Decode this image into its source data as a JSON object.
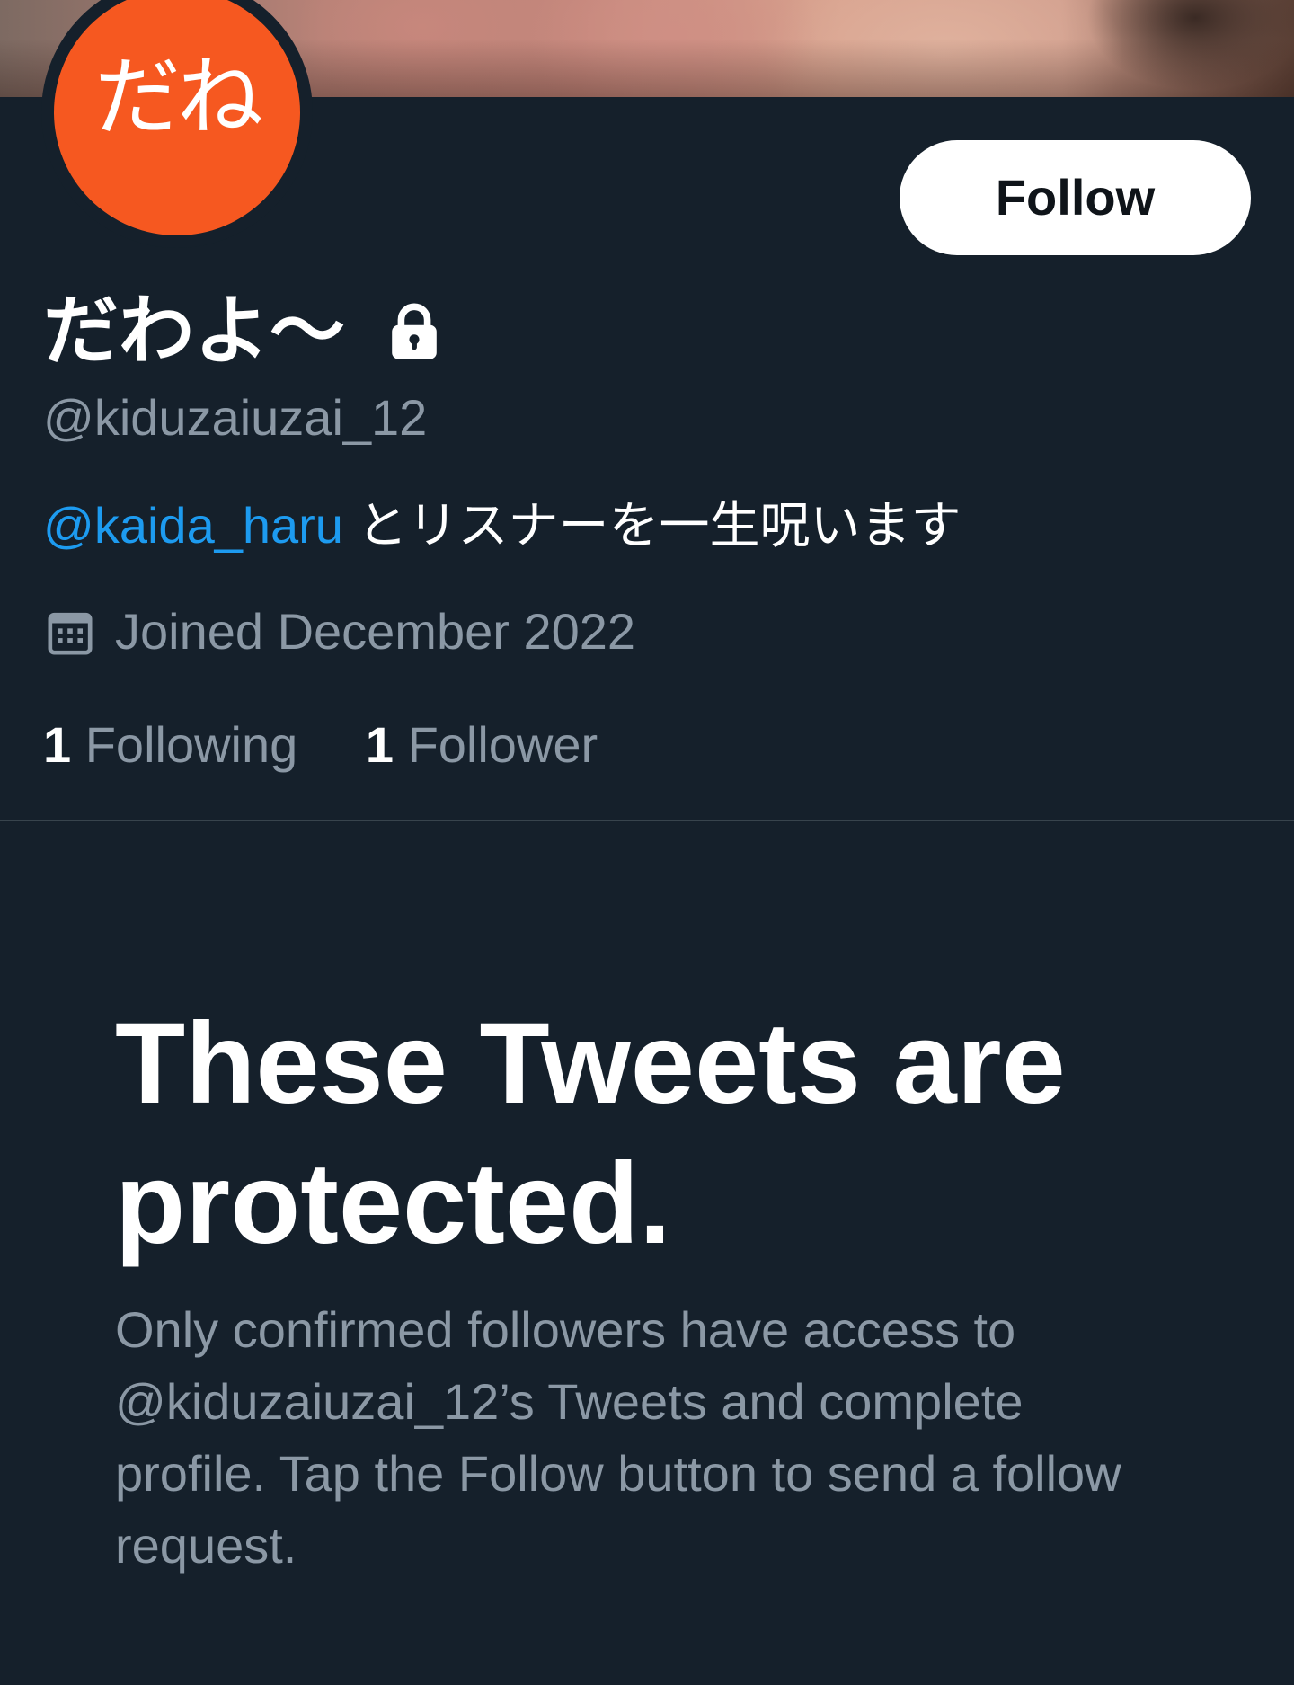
{
  "profile": {
    "avatar_text": "だね",
    "display_name": "だわよ〜",
    "handle": "@kiduzaiuzai_12",
    "bio_mention": "@kaida_haru",
    "bio_text": " とリスナーを一生呪います",
    "joined": "Joined December 2022",
    "following_count": "1",
    "following_label": "Following",
    "followers_count": "1",
    "followers_label": "Follower",
    "protected_icon": "lock-icon",
    "joined_icon": "calendar-icon"
  },
  "actions": {
    "follow_label": "Follow"
  },
  "protected_notice": {
    "title": "These Tweets are protected.",
    "body": "Only confirmed followers have access to @kiduzaiuzai_12’s Tweets and complete profile. Tap the Follow button to send a follow request."
  },
  "colors": {
    "background": "#15202b",
    "avatar": "#f65820",
    "link": "#1d9bf0",
    "secondary_text": "#8b98a5"
  }
}
